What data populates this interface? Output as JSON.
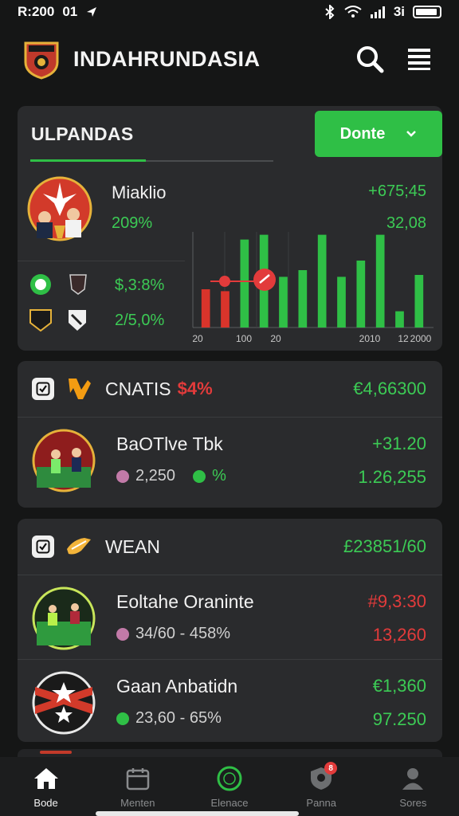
{
  "status": {
    "time": "R:200",
    "left_extra": "01",
    "right_signal": "3i"
  },
  "header": {
    "title": "INDAHRUNDASIA"
  },
  "overview": {
    "title": "ULPANDAS",
    "dropdown": "Donte",
    "player": {
      "name": "Miaklio",
      "pct": "209%",
      "val1": "+675;45",
      "val2": "32,08"
    },
    "stat_a": "$,3:8%",
    "stat_b": "2/5,0%",
    "chart_data": {
      "type": "bar",
      "x_tick_labels": [
        "20",
        "100",
        "20",
        "2010",
        "12",
        "2000"
      ],
      "series": [
        {
          "name": "",
          "values": [
            0.4,
            0.38,
            0.92,
            0.97,
            0.53,
            0.6,
            0.97,
            0.53,
            0.7,
            0.97,
            0.17,
            0.55
          ]
        }
      ]
    }
  },
  "section2": {
    "title": "CNATIS",
    "badge": "$4%",
    "value": "€4,66300",
    "match": {
      "title": "BaOTlve Tbk",
      "sub_left": "2,250",
      "sub_right": "%",
      "val_top": "+31.20",
      "val_bot": "1.26,255"
    }
  },
  "section3": {
    "title": "WEAN",
    "value": "£23851/60",
    "matches": [
      {
        "title": "Eoltahe Oranintе",
        "sub": "34/60 - 458%",
        "val_top": "#9,3:30",
        "val_bot": "13,260",
        "color": "red"
      },
      {
        "title": "Gaan Anbatidn",
        "sub": "23,60 - 65%",
        "val_top": "€1,360",
        "val_bot": "97.250",
        "color": "green"
      }
    ]
  },
  "nav": [
    {
      "label": "Bode",
      "icon": "home-icon",
      "active": true
    },
    {
      "label": "Menten",
      "icon": "calendar-icon",
      "active": false
    },
    {
      "label": "Elenace",
      "icon": "ball-icon",
      "active": false
    },
    {
      "label": "Panna",
      "icon": "shield-icon",
      "active": false,
      "badge": "8"
    },
    {
      "label": "Sores",
      "icon": "profile-icon",
      "active": false
    }
  ]
}
